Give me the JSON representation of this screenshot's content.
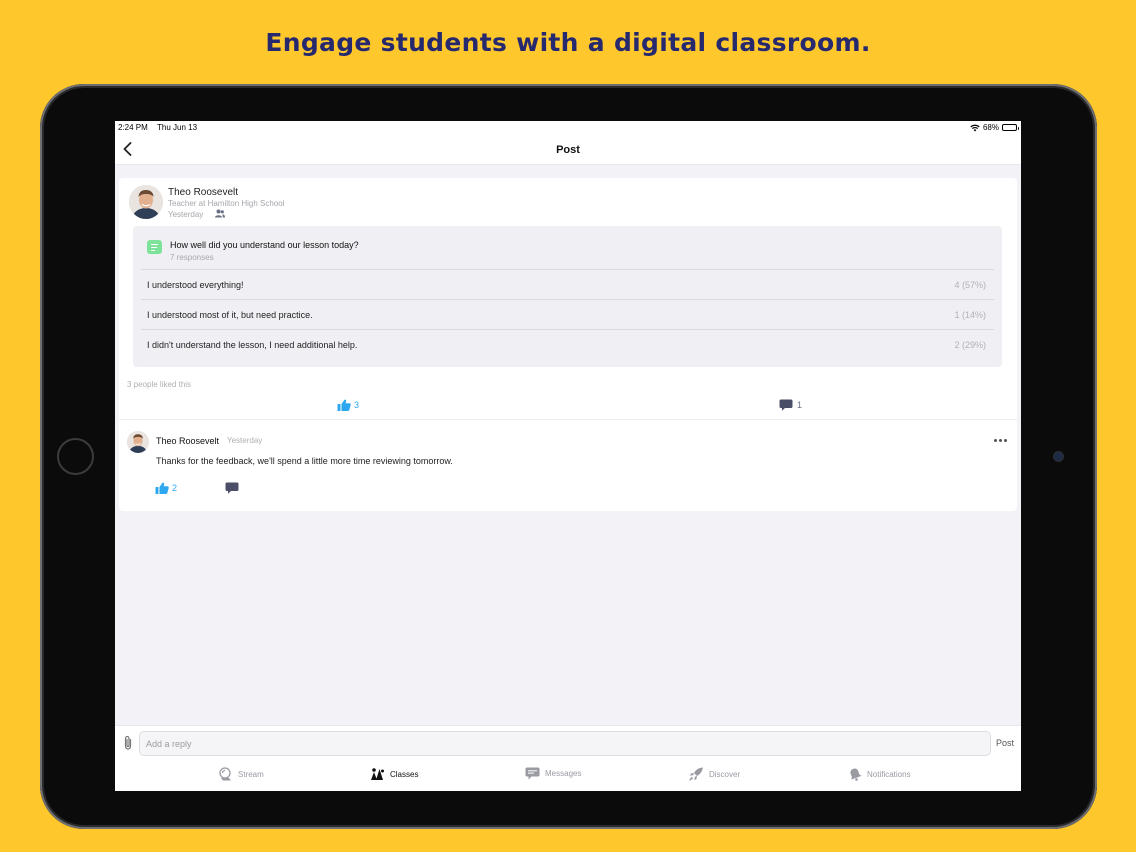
{
  "headline": "Engage students with a digital classroom.",
  "status_bar": {
    "time": "2:24 PM",
    "date": "Thu Jun 13",
    "battery": "68%",
    "battery_level": 0.68
  },
  "nav": {
    "title": "Post"
  },
  "post": {
    "author": "Theo Roosevelt",
    "role": "Teacher at Hamilton High School",
    "time": "Yesterday",
    "poll": {
      "question": "How well did you understand our lesson today?",
      "responses": "7 responses",
      "options": [
        {
          "label": "I understood everything!",
          "result": "4 (57%)"
        },
        {
          "label": "I understood most of it, but need practice.",
          "result": "1 (14%)"
        },
        {
          "label": "I didn't understand the lesson, I need additional help.",
          "result": "2 (29%)"
        }
      ]
    },
    "likes_summary": "3 people liked this",
    "like_count": "3",
    "comment_count": "1"
  },
  "comment": {
    "author": "Theo Roosevelt",
    "time": "Yesterday",
    "text": "Thanks for the feedback, we'll spend a little more time reviewing tomorrow.",
    "like_count": "2"
  },
  "reply": {
    "placeholder": "Add a reply",
    "post_label": "Post"
  },
  "tabs": {
    "stream": "Stream",
    "classes": "Classes",
    "messages": "Messages",
    "discover": "Discover",
    "notifications": "Notifications"
  },
  "colors": {
    "background": "#FEC82C",
    "headline": "#26296E",
    "accent": "#2DA8F0",
    "poll_icon": "#7EE39A"
  }
}
